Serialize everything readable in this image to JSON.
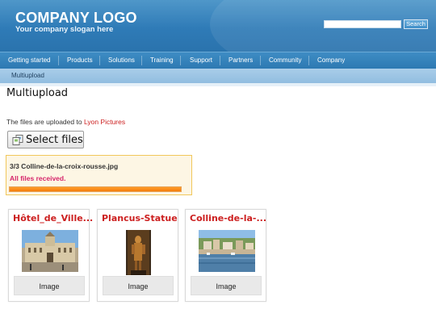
{
  "header": {
    "logo_title": "COMPANY LOGO",
    "slogan": "Your company slogan here",
    "search_placeholder": "",
    "search_button": "Search"
  },
  "nav": {
    "items": [
      "Getting started",
      "Products",
      "Solutions",
      "Training",
      "Support",
      "Partners",
      "Community",
      "Company"
    ]
  },
  "subnav": {
    "items": [
      "Multiupload"
    ]
  },
  "main": {
    "title": "Multiupload",
    "upload_info_prefix": "The files are uploaded to",
    "upload_info_link": "Lyon Pictures",
    "select_button": "Select files"
  },
  "progress": {
    "file": "3/3  Colline-de-la-croix-rousse.jpg",
    "status": "All files received.",
    "percent": 100
  },
  "thumbnails": [
    {
      "title": "Hôtel_de_Ville...",
      "button": "Image"
    },
    {
      "title": "Plancus-Statue",
      "button": "Image"
    },
    {
      "title": "Colline-de-la-...",
      "button": "Image"
    }
  ],
  "colors": {
    "header_blue": "#2f7bb7",
    "link_red": "#cc1f1f",
    "status_pink": "#d6246a",
    "progress_orange": "#f47d0a",
    "progress_box_bg": "#fdf6e4"
  }
}
